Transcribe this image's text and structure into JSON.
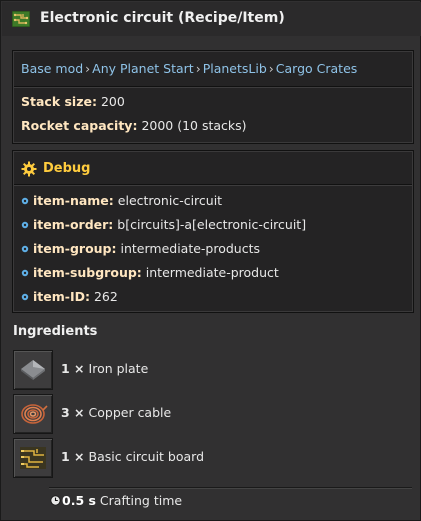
{
  "title": "Electronic circuit (Recipe/Item)",
  "breadcrumb": [
    "Base mod",
    "Any Planet Start",
    "PlanetsLib",
    "Cargo Crates"
  ],
  "info": [
    {
      "key": "Stack size:",
      "value": "200"
    },
    {
      "key": "Rocket capacity:",
      "value": "2000 (10 stacks)"
    }
  ],
  "debug": {
    "title": "Debug",
    "rows": [
      {
        "key": "item-name:",
        "value": "electronic-circuit"
      },
      {
        "key": "item-order:",
        "value": "b[circuits]-a[electronic-circuit]"
      },
      {
        "key": "item-group:",
        "value": "intermediate-products"
      },
      {
        "key": "item-subgroup:",
        "value": "intermediate-product"
      },
      {
        "key": "item-ID:",
        "value": "262"
      }
    ]
  },
  "ingredients": {
    "title": "Ingredients",
    "items": [
      {
        "amount": "1 ×",
        "name": "Iron plate",
        "icon": "iron-plate-icon"
      },
      {
        "amount": "3 ×",
        "name": "Copper cable",
        "icon": "copper-cable-icon"
      },
      {
        "amount": "1 ×",
        "name": "Basic circuit board",
        "icon": "basic-circuit-board-icon"
      }
    ]
  },
  "crafting": {
    "value": "0.5 s",
    "label": "Crafting time"
  },
  "colors": {
    "link": "#8fc3e8",
    "key": "#ffe6c0",
    "debug_title": "#ffcc3e",
    "panel_bg": "#242324",
    "window_bg": "#313031"
  }
}
